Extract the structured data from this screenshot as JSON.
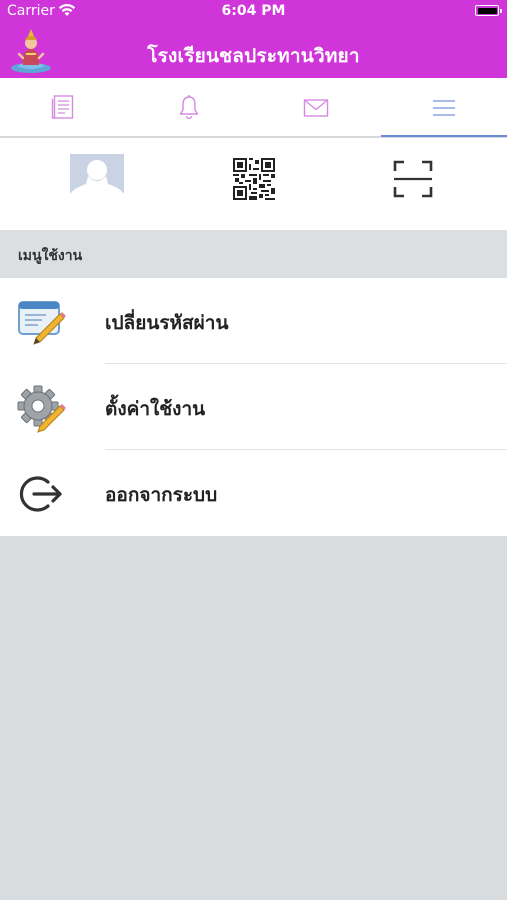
{
  "status_bar": {
    "carrier": "Carrier",
    "time": "6:04 PM"
  },
  "header": {
    "title": "โรงเรียนชลประทานวิทยา",
    "background": "#cf35d8"
  },
  "tabs": [
    {
      "name": "news",
      "icon": "document-icon",
      "active": false
    },
    {
      "name": "notifications",
      "icon": "bell-icon",
      "active": false
    },
    {
      "name": "messages",
      "icon": "envelope-icon",
      "active": false
    },
    {
      "name": "menu",
      "icon": "hamburger-icon",
      "active": true
    }
  ],
  "quick_actions": [
    {
      "name": "profile",
      "icon": "avatar-placeholder-icon"
    },
    {
      "name": "my-qr",
      "icon": "qr-code-icon"
    },
    {
      "name": "scan",
      "icon": "scan-frame-icon"
    }
  ],
  "section": {
    "title": "เมนูใช้งาน"
  },
  "menu": {
    "items": [
      {
        "label": "เปลี่ยนรหัสผ่าน",
        "icon": "edit-form-icon"
      },
      {
        "label": "ตั้งค่าใช้งาน",
        "icon": "settings-gear-icon"
      },
      {
        "label": "ออกจากระบบ",
        "icon": "logout-icon"
      }
    ]
  },
  "colors": {
    "accent": "#6b88d9",
    "tab_icon": "#d48be0",
    "page_bg": "#d9dcdf"
  }
}
